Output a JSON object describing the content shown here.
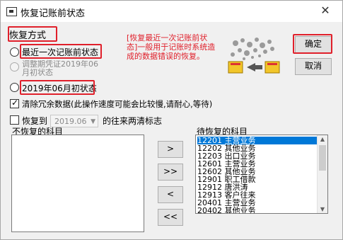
{
  "window": {
    "title": "恢复记账前状态",
    "close_glyph": "✕"
  },
  "restore_mode": {
    "group_label": "恢复方式",
    "options": [
      {
        "label": "最近一次记账前状态",
        "checked": false,
        "enabled": true
      },
      {
        "label": "调整期凭证2019年06月初状态",
        "line1": "调整期凭证2019年06",
        "line2": "月初状态",
        "checked": false,
        "enabled": false
      },
      {
        "label": "2019年06月初状态",
        "checked": false,
        "enabled": true
      }
    ],
    "note": "[恢复最近一次记账前状态]一般用于记账时系统造成的数据错误的恢复。"
  },
  "buttons": {
    "ok": "确定",
    "cancel": "取消"
  },
  "cleanup": {
    "label": "清除冗余数据(此操作速度可能会比较慢,请耐心,等待)",
    "checked": true
  },
  "restore_to": {
    "label": "恢复到",
    "checked": false,
    "period": "2019.06",
    "suffix": "的往来两清标志"
  },
  "not_restored": {
    "label": "不恢复的科目",
    "items": []
  },
  "to_restore": {
    "label": "待恢复的科目",
    "items": [
      {
        "code": "12201",
        "name": "主营业务",
        "selected": true
      },
      {
        "code": "12202",
        "name": "其他业务",
        "selected": false
      },
      {
        "code": "12203",
        "name": "出口业务",
        "selected": false
      },
      {
        "code": "12601",
        "name": "主营业务",
        "selected": false
      },
      {
        "code": "12602",
        "name": "其他业务",
        "selected": false
      },
      {
        "code": "12901",
        "name": "职工借款",
        "selected": false
      },
      {
        "code": "12912",
        "name": "唐洪涛",
        "selected": false
      },
      {
        "code": "12913",
        "name": "客户往来",
        "selected": false
      },
      {
        "code": "20401",
        "name": "主营业务",
        "selected": false
      },
      {
        "code": "20402",
        "name": "其他业务",
        "selected": false
      }
    ]
  },
  "transfer_buttons": {
    "move_one": ">",
    "move_all": ">>",
    "back_one": "<",
    "back_all": "<<"
  },
  "icons": {
    "window": "app-window-icon",
    "close": "close-icon",
    "illustration": "restore-data-illustration"
  },
  "colors": {
    "highlight": "#e0202b",
    "selection": "#0078d7",
    "note": "#e0202b"
  }
}
